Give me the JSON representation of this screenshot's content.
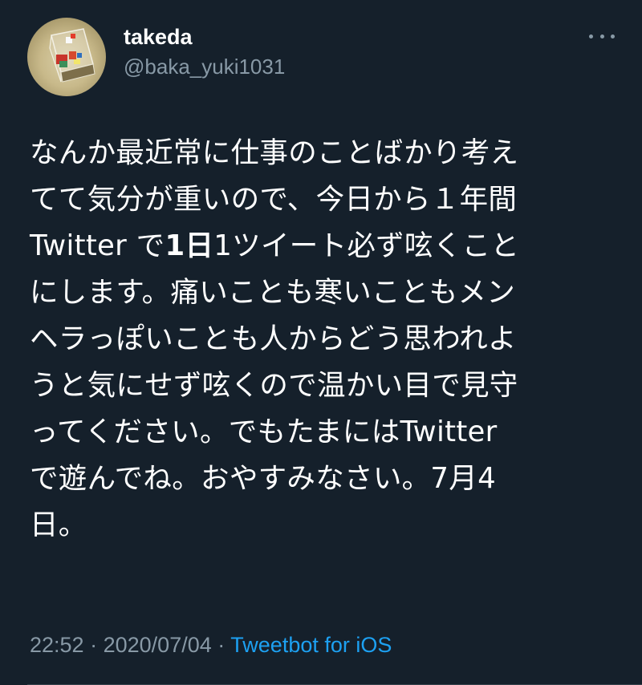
{
  "tweet": {
    "display_name": "takeda",
    "handle": "@baka_yuki1031",
    "body_lines": [
      [
        "なんか最近常に仕事のことばかり考え"
      ],
      [
        "てて気分が重いので、今日から１年間"
      ],
      [
        "Twitter で",
        "1日",
        "1ツイート必ず呟くこと"
      ],
      [
        "にします。痛いことも寒いこともメン"
      ],
      [
        "ヘラっぽいことも人からどう思われよ"
      ],
      [
        "うと気にせず呟くので温かい目で見守"
      ],
      [
        "ってください。でもたまにはTwitter"
      ],
      [
        "で遊んでね。おやすみなさい。7月4"
      ],
      [
        "日。"
      ]
    ],
    "time": "22:52",
    "separator": "·",
    "date": "2020/07/04",
    "source": "Tweetbot for iOS",
    "more_icon": "more-horizontal-icon"
  },
  "colors": {
    "background": "#15202b",
    "text": "#ffffff",
    "secondary_text": "#8899a6",
    "link": "#1da1f2",
    "divider": "#38444d"
  }
}
